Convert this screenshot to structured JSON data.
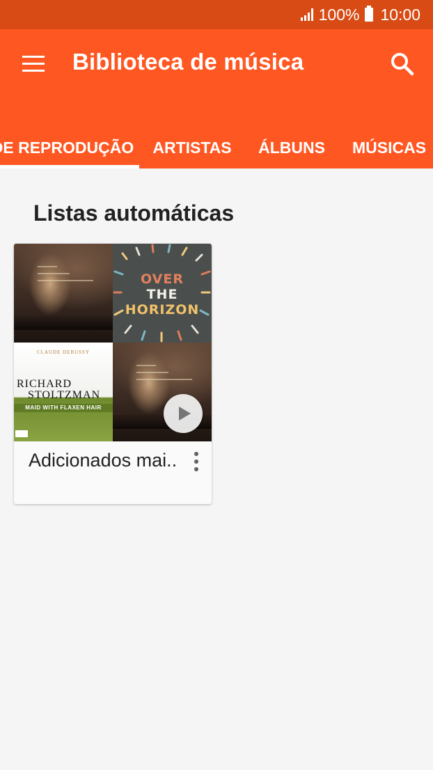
{
  "status_bar": {
    "battery": "100%",
    "time": "10:00",
    "bar_color": "#d84b15"
  },
  "app_bar": {
    "title": "Biblioteca de música",
    "color": "#ff5722",
    "menu_icon": "hamburger-menu-icon",
    "search_icon": "search-icon"
  },
  "tabs": [
    {
      "label": "DE REPRODUÇÃO",
      "selected": true
    },
    {
      "label": "ARTISTAS",
      "selected": false
    },
    {
      "label": "ÁLBUNS",
      "selected": false
    },
    {
      "label": "MÚSICAS",
      "selected": false
    }
  ],
  "section": {
    "title": "Listas automáticas"
  },
  "playlist_card": {
    "label": "Adicionados mai..",
    "art": {
      "horizon_lines": [
        "OVER",
        "THE",
        "HORIZON"
      ],
      "debussy_top": "CLAUDE DEBUSSY",
      "debussy_artist_lines": [
        "RICHARD",
        "STOLTZMAN"
      ],
      "debussy_album": "MAID WITH FLAXEN HAIR"
    },
    "play_icon": "play-icon",
    "more_icon": "more-vertical-icon"
  }
}
